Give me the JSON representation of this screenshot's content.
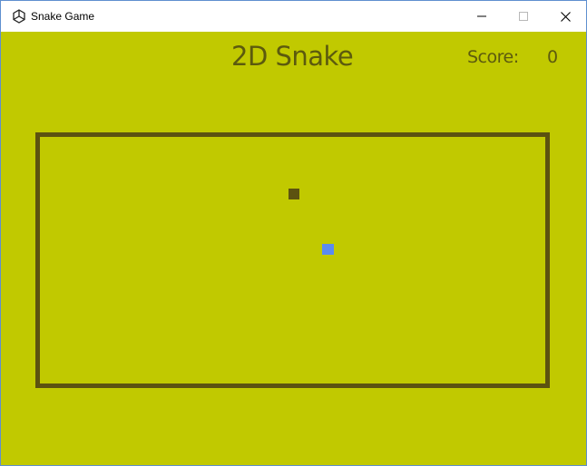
{
  "window": {
    "title": "Snake Game",
    "controls": [
      "minimize-icon",
      "maximize-icon",
      "close-icon"
    ]
  },
  "game": {
    "title": "2D Snake",
    "score_label": "Score:",
    "score_value": "0"
  },
  "colors": {
    "background": "#c1c900",
    "text": "#5c5a0e",
    "wall": "#5c5210",
    "food": "#5c5210",
    "snake": "#5b8bf0"
  }
}
